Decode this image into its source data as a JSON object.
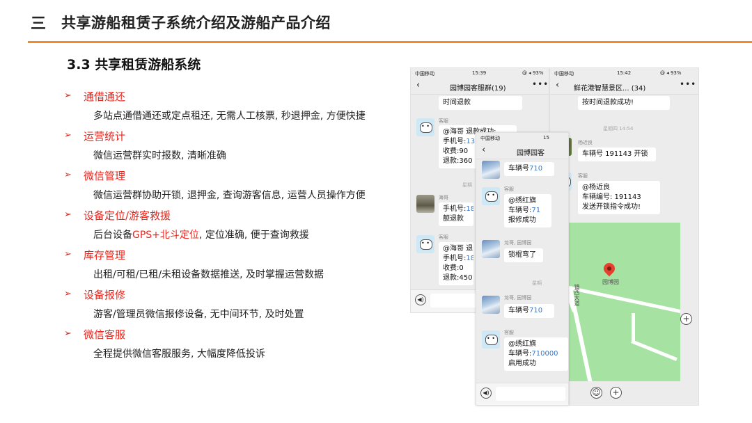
{
  "header": {
    "section_num": "三",
    "title": "共享游船租赁子系统介绍及游船产品介绍"
  },
  "sub_title": "3.3 共享租赁游船系统",
  "features": [
    {
      "title": "通借通还",
      "desc": "多站点通借通还或定点租还, 无需人工核票, 秒退押金, 方便快捷"
    },
    {
      "title": "运营统计",
      "desc": "微信运营群实时报数, 清晰准确"
    },
    {
      "title": "微信管理",
      "desc": "微信运营群协助开锁, 退押金, 查询游客信息, 运营人员操作方便"
    },
    {
      "title": "设备定位/游客救援",
      "desc_pre": "后台设备",
      "desc_hl": "GPS+北斗定位",
      "desc_post": ", 定位准确, 便于查询救援"
    },
    {
      "title": "库存管理",
      "desc": "出租/可租/已租/未租设备数据推送, 及时掌握运营数据"
    },
    {
      "title": "设备报修",
      "desc": "游客/管理员微信报修设备, 无中间环节, 及时处置"
    },
    {
      "title": "微信客服",
      "desc": "全程提供微信客服服务, 大幅度降低投诉"
    }
  ],
  "phone1": {
    "carrier": "中国移动",
    "time": "15:39",
    "battery": "@ ◂ 93%",
    "chat_title": "园博园客服群(19)",
    "bubble0": "时间退款",
    "sender_robot": "客服",
    "b1_line1": "@海哥 退款成功:",
    "b1_line2_pre": "手机号:",
    "b1_line2_num": "13",
    "b1_line3": "收费:90",
    "b1_line4": "退款:360",
    "time_label": "星期",
    "sender_haige": "海哥",
    "b2_line1_pre": "手机号:",
    "b2_line1_num": "188",
    "b2_line2": "额退款",
    "b3_line1": "@海哥 退",
    "b3_line2_pre": "手机号:",
    "b3_line2_num": "18",
    "b3_line3": "收费:0",
    "b3_line4": "退款:450"
  },
  "phone2": {
    "carrier": "中国移动",
    "time": "15",
    "chat_title": "园博园客",
    "b0_pre": "车辆号",
    "b0_num": "710",
    "sender_robot": "客服",
    "b1_line1": "@绣红旗",
    "b1_line2_pre": "车辆号:",
    "b1_line2_num": "71",
    "b1_line3": "报修成功",
    "sender_long": "龙哥, 园博园",
    "b2": "锁棍弯了",
    "time_label": "星期",
    "b3_pre": "车辆号",
    "b3_num": "710",
    "b4_line1": "@绣红旗",
    "b4_line2_pre": "车辆号:",
    "b4_line2_num": "710000",
    "b4_line3": "启用成功"
  },
  "phone3": {
    "carrier": "中国移动",
    "time": "15:42",
    "battery": "@ ◂ 93%",
    "chat_title": "鲜花港智慧景区...",
    "chat_count": "(34)",
    "b0": "按时间退款成功!",
    "time_label": "星期四 14:54",
    "sender_yang": "杨近良",
    "b1": "车辆号 191143 开锁",
    "sender_robot": "客服",
    "b2_line1": "@杨近良",
    "b2_line2": "车辆编号: 191143",
    "b2_line3": "发送开锁指令成功!",
    "map_place": "园博园",
    "map_road": "镇西大道"
  }
}
